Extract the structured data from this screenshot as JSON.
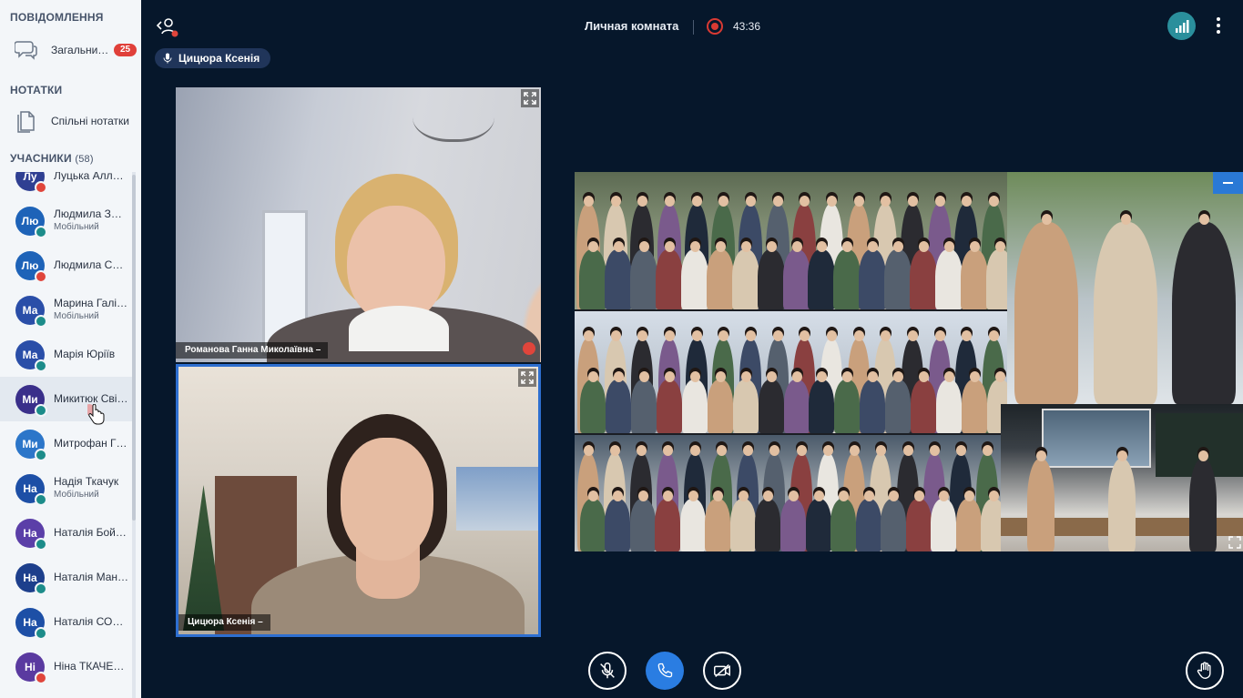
{
  "sidebar": {
    "messages_title": "ПОВІДОМЛЕННЯ",
    "chat_label": "Загальни…",
    "chat_badge": "25",
    "notes_title": "НОТАТКИ",
    "notes_label": "Спільні нотатки",
    "participants_title": "УЧАСНИКИ",
    "participants_count": "(58)",
    "participants": [
      {
        "initials": "Лу",
        "name": "Луцька Алл…",
        "sub": "",
        "color": "#2f3f92",
        "status": "red"
      },
      {
        "initials": "Лю",
        "name": "Людмила З…",
        "sub": "Мобільний",
        "color": "#1e63b8",
        "status": "teal"
      },
      {
        "initials": "Лю",
        "name": "Людмила С…",
        "sub": "",
        "color": "#1e63b8",
        "status": "red"
      },
      {
        "initials": "Ма",
        "name": "Марина Галі…",
        "sub": "Мобільний",
        "color": "#2a4ea8",
        "status": "teal"
      },
      {
        "initials": "Ма",
        "name": "Марія Юріїв",
        "sub": "",
        "color": "#2a4ea8",
        "status": "teal"
      },
      {
        "initials": "Ми",
        "name": "Микитюк Сві…",
        "sub": "",
        "color": "#3a2f8a",
        "status": "teal"
      },
      {
        "initials": "Ми",
        "name": "Митрофан Г…",
        "sub": "",
        "color": "#2c76c9",
        "status": "teal"
      },
      {
        "initials": "На",
        "name": "Надія Ткачук",
        "sub": "Мобільний",
        "color": "#1d4fa6",
        "status": "teal"
      },
      {
        "initials": "На",
        "name": "Наталія Бой…",
        "sub": "",
        "color": "#5b3fa8",
        "status": "teal"
      },
      {
        "initials": "На",
        "name": "Наталія Ман…",
        "sub": "",
        "color": "#1d3f8c",
        "status": "teal"
      },
      {
        "initials": "На",
        "name": "Наталія СО…",
        "sub": "",
        "color": "#1d4fa6",
        "status": "teal"
      },
      {
        "initials": "Ні",
        "name": "Ніна ТКАЧЕ…",
        "sub": "",
        "color": "#5a3aa0",
        "status": "red"
      }
    ]
  },
  "topbar": {
    "room_title": "Личная комната",
    "recording_time": "43:36"
  },
  "speaker": {
    "name": "Цицюра Ксенія"
  },
  "tiles": {
    "tile1_name": "Романова Ганна Миколаївна –",
    "tile2_name": "Цицюра Ксенія –"
  },
  "colors": {
    "background": "#06172b",
    "accent": "#2a7de2",
    "record": "#d93a33",
    "badge": "#e0403a"
  }
}
